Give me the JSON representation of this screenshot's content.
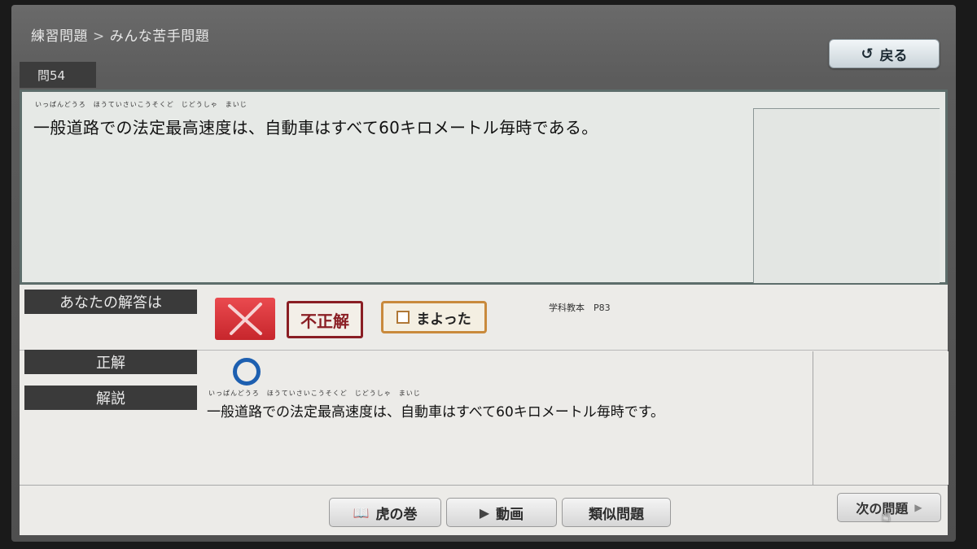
{
  "breadcrumb": {
    "parent": "練習問題",
    "separator": ">",
    "current": "みんな苦手問題"
  },
  "back_button": {
    "label": "戻る"
  },
  "question": {
    "number_label": "問54",
    "ruby": "いっぱんどうろ　ほうていさいこうそくど　じどうしゃ　まいじ",
    "text": "一般道路での法定最高速度は、自動車はすべて60キロメートル毎時である。"
  },
  "answer_section": {
    "your_answer_label": "あなたの解答は",
    "result_stamp": "不正解",
    "confused_label": "まよった",
    "textbook_ref": "学科教本　P83"
  },
  "correct_section": {
    "label": "正解",
    "mark": "○"
  },
  "explanation_section": {
    "label": "解説",
    "ruby": "いっぱんどうろ　ほうていさいこうそくど　じどうしゃ　まいじ",
    "text": "一般道路での法定最高速度は、自動車はすべて60キロメートル毎時です。"
  },
  "footer": {
    "tora_no_maki": "虎の巻",
    "video": "動画",
    "similar": "類似問題",
    "next": "次の問題"
  },
  "colors": {
    "wrong_red": "#c7262c",
    "correct_blue": "#1d5fb0",
    "stamp_red": "#8a1e24"
  }
}
